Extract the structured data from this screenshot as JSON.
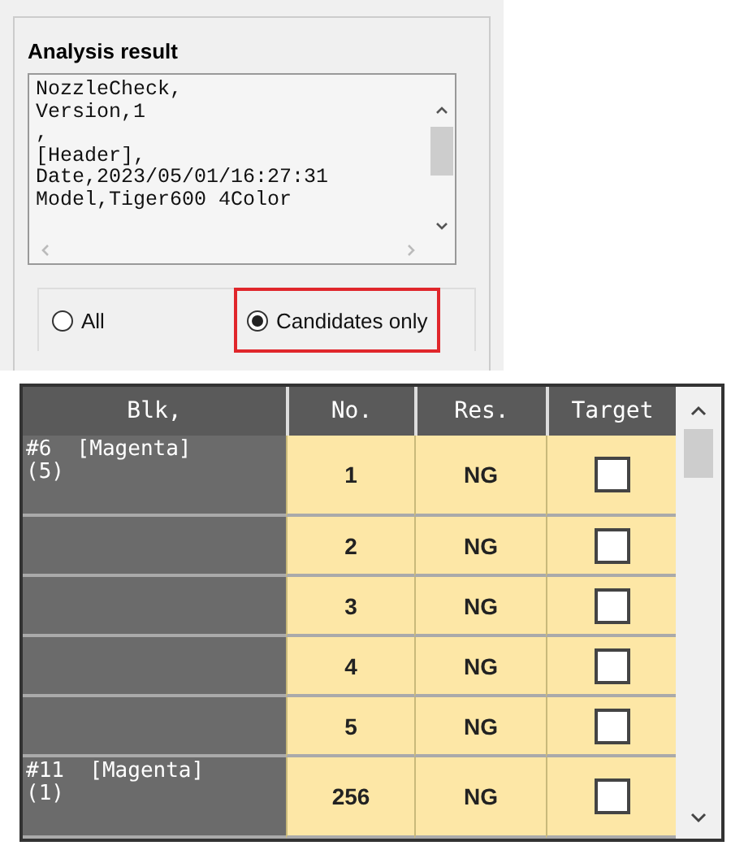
{
  "analysis_result": {
    "title": "Analysis result",
    "text_lines": [
      "NozzleCheck,",
      "Version,1",
      ",",
      "[Header],",
      "Date,2023/05/01/16:27:31",
      "Model,Tiger600 4Color"
    ],
    "filter": [
      {
        "label": "All",
        "selected": false
      },
      {
        "label": "Candidates only",
        "selected": true,
        "highlighted": true
      }
    ]
  },
  "table": {
    "columns": [
      "Blk,",
      "No.",
      "Res.",
      "Target"
    ],
    "rows": [
      {
        "blk": "#6  [Magenta]\n(5)",
        "no": "1",
        "res": "NG",
        "target": false
      },
      {
        "no": "2",
        "res": "NG",
        "target": false
      },
      {
        "no": "3",
        "res": "NG",
        "target": false
      },
      {
        "no": "4",
        "res": "NG",
        "target": false
      },
      {
        "no": "5",
        "res": "NG",
        "target": false
      },
      {
        "blk": "#11  [Magenta]\n(1)",
        "no": "256",
        "res": "NG",
        "target": false
      }
    ]
  }
}
